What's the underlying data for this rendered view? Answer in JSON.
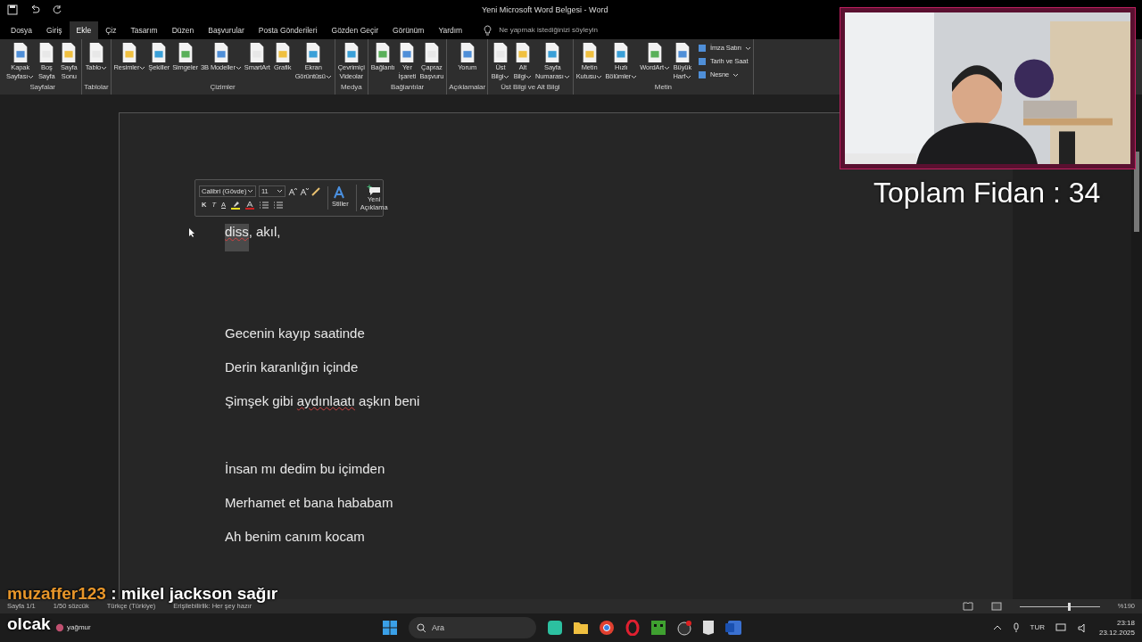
{
  "window": {
    "title": "Yeni Microsoft Word Belgesi  -  Word"
  },
  "tabs": [
    {
      "label": "Dosya",
      "selected": false
    },
    {
      "label": "Giriş",
      "selected": false
    },
    {
      "label": "Ekle",
      "selected": true
    },
    {
      "label": "Çiz",
      "selected": false
    },
    {
      "label": "Tasarım",
      "selected": false
    },
    {
      "label": "Düzen",
      "selected": false
    },
    {
      "label": "Başvurular",
      "selected": false
    },
    {
      "label": "Posta Gönderileri",
      "selected": false
    },
    {
      "label": "Gözden Geçir",
      "selected": false
    },
    {
      "label": "Görünüm",
      "selected": false
    },
    {
      "label": "Yardım",
      "selected": false
    }
  ],
  "tell_me": {
    "placeholder": "Ne yapmak istediğinizi söyleyin"
  },
  "ribbon": [
    {
      "label": "Sayfalar",
      "items": [
        {
          "lines": [
            "Kapak",
            "Sayfası"
          ],
          "dropdown": true
        },
        {
          "lines": [
            "Boş",
            "Sayfa"
          ],
          "dropdown": false
        },
        {
          "lines": [
            "Sayfa",
            "Sonu"
          ],
          "dropdown": false
        }
      ]
    },
    {
      "label": "Tablolar",
      "items": [
        {
          "lines": [
            "Tablo"
          ],
          "dropdown": true
        }
      ]
    },
    {
      "label": "Çizimler",
      "items": [
        {
          "lines": [
            "Resimler"
          ],
          "dropdown": true
        },
        {
          "lines": [
            "Şekiller"
          ],
          "dropdown": false
        },
        {
          "lines": [
            "Simgeler"
          ],
          "dropdown": false
        },
        {
          "lines": [
            "3B Modeller"
          ],
          "dropdown": true
        },
        {
          "lines": [
            "SmartArt"
          ],
          "dropdown": false
        },
        {
          "lines": [
            "Grafik"
          ],
          "dropdown": false
        },
        {
          "lines": [
            "Ekran",
            "Görüntüsü"
          ],
          "dropdown": true
        }
      ]
    },
    {
      "label": "Medya",
      "items": [
        {
          "lines": [
            "Çevrimiçi",
            "Videolar"
          ],
          "dropdown": false
        }
      ]
    },
    {
      "label": "Bağlantılar",
      "items": [
        {
          "lines": [
            "Bağlantı"
          ],
          "dropdown": false
        },
        {
          "lines": [
            "Yer",
            "İşareti"
          ],
          "dropdown": false
        },
        {
          "lines": [
            "Çapraz",
            "Başvuru"
          ],
          "dropdown": false
        }
      ]
    },
    {
      "label": "Açıklamalar",
      "items": [
        {
          "lines": [
            "Yorum"
          ],
          "dropdown": false
        }
      ]
    },
    {
      "label": "Üst Bilgi ve Alt Bilgi",
      "items": [
        {
          "lines": [
            "Üst",
            "Bilgi"
          ],
          "dropdown": true
        },
        {
          "lines": [
            "Alt",
            "Bilgi"
          ],
          "dropdown": true
        },
        {
          "lines": [
            "Sayfa",
            "Numarası"
          ],
          "dropdown": true
        }
      ]
    },
    {
      "label": "Metin",
      "items": [
        {
          "lines": [
            "Metin",
            "Kutusu"
          ],
          "dropdown": true
        },
        {
          "lines": [
            "Hızlı",
            "Bölümler"
          ],
          "dropdown": true
        },
        {
          "lines": [
            "WordArt"
          ],
          "dropdown": true
        },
        {
          "lines": [
            "Büyük",
            "Harf"
          ],
          "dropdown": true
        }
      ],
      "small_items": [
        {
          "label": "İmza Satırı",
          "dropdown": true
        },
        {
          "label": "Tarih ve Saat",
          "dropdown": false
        },
        {
          "label": "Nesne",
          "dropdown": true
        }
      ]
    }
  ],
  "mini_toolbar": {
    "font": "Calibri (Gövde)",
    "size": "11",
    "bold": "K",
    "italic": "T",
    "underline": "A",
    "styles": "Stiller",
    "comment": [
      "Yeni",
      "Açıklama"
    ]
  },
  "document": {
    "paragraphs": [
      {
        "kind": "text",
        "segments": [
          {
            "text": "diss",
            "selected": true,
            "misspelled": true
          },
          {
            "text": ", akıl,",
            "selected": false,
            "misspelled": false
          }
        ]
      },
      {
        "kind": "blank"
      },
      {
        "kind": "blank"
      },
      {
        "kind": "text",
        "segments": [
          {
            "text": "Gecenin kayıp saatinde",
            "selected": false,
            "misspelled": false
          }
        ]
      },
      {
        "kind": "text",
        "segments": [
          {
            "text": "Derin karanlığın içinde",
            "selected": false,
            "misspelled": false
          }
        ]
      },
      {
        "kind": "text",
        "segments": [
          {
            "text": "Şimşek gibi ",
            "selected": false,
            "misspelled": false
          },
          {
            "text": "aydınlaatı",
            "selected": false,
            "misspelled": true
          },
          {
            "text": " aşkın beni",
            "selected": false,
            "misspelled": false
          }
        ]
      },
      {
        "kind": "blank"
      },
      {
        "kind": "text",
        "segments": [
          {
            "text": "İnsan mı dedim bu içimden",
            "selected": false,
            "misspelled": false
          }
        ]
      },
      {
        "kind": "text",
        "segments": [
          {
            "text": "Merhamet et bana hababam",
            "selected": false,
            "misspelled": false
          }
        ]
      },
      {
        "kind": "text",
        "segments": [
          {
            "text": "Ah benim canım kocam",
            "selected": false,
            "misspelled": false
          }
        ]
      }
    ]
  },
  "status_bar": {
    "page": "Sayfa 1/1",
    "words": "1/50 sözcük",
    "language": "Türkçe (Türkiye)",
    "accessibility": "Erişilebilirlik: Her şey hazır",
    "zoom": "%190",
    "zoom_slider": {
      "level": 0.6
    }
  },
  "taskbar": {
    "weather": "yağmur",
    "search": {
      "placeholder": "Ara"
    },
    "language": "TUR",
    "time": "23:18",
    "date": "23.12.2025"
  },
  "overlay": {
    "counter": "Toplam Fidan : 34",
    "chat": {
      "user": "muzaffer123",
      "color": "#e8962a",
      "message": " : mikel jackson sağır",
      "continuation": "olcak"
    }
  }
}
